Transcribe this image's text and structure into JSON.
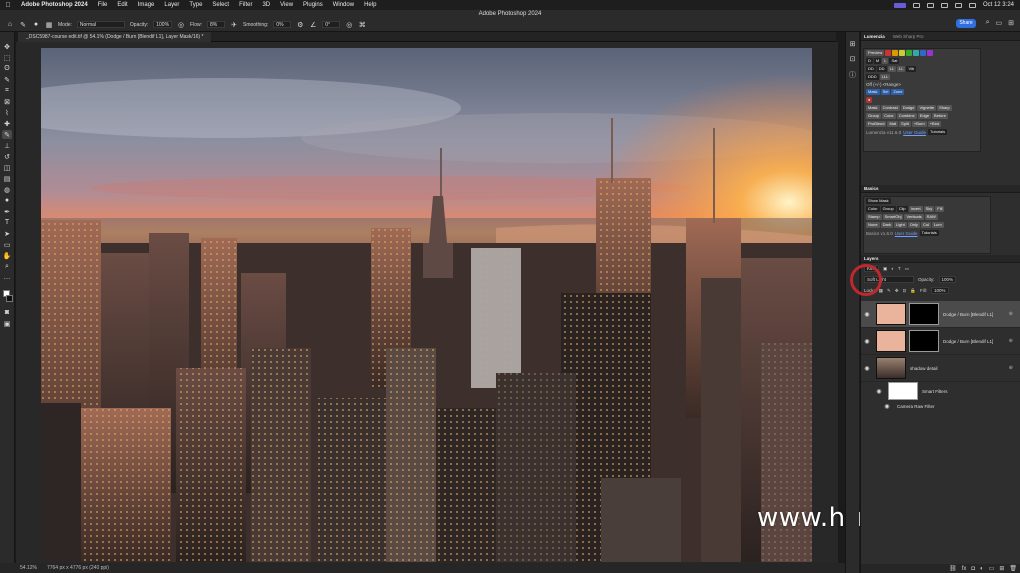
{
  "menubar": {
    "apple": "",
    "items": [
      "Adobe Photoshop 2024",
      "File",
      "Edit",
      "Image",
      "Layer",
      "Type",
      "Select",
      "Filter",
      "3D",
      "View",
      "Plugins",
      "Window",
      "Help"
    ],
    "clock": "Oct 12  3:24"
  },
  "window": {
    "title": "Adobe Photoshop 2024"
  },
  "options": {
    "mode_label": "Mode:",
    "mode_value": "Normal",
    "opacity_label": "Opacity:",
    "opacity_value": "100%",
    "flow_label": "Flow:",
    "flow_value": "8%",
    "smoothing_label": "Smoothing:",
    "smoothing_value": "0%",
    "angle_value": "0°",
    "share_label": "Share"
  },
  "document": {
    "tab_label": "_DSC5987-course edit.tif @ 54.1% (Dodge / Burn [Blendif L1], Layer Mask/16) *"
  },
  "status": {
    "zoom": "54.12%",
    "dimensions": "7764 px x 4776 px (240 ppi)"
  },
  "watermark": "www.hunls.com",
  "panels": {
    "lumenzia_tabs": [
      "Lumenzia",
      "Web Sharp Pro"
    ],
    "lumenzia": {
      "preview": "Preview",
      "zones_row1": [
        "D",
        "M",
        "L",
        "Sat"
      ],
      "zones_row2": [
        "DD",
        "DD",
        "LL",
        "LL",
        "Vib"
      ],
      "zones_row3": [
        "DDD",
        "LLL"
      ],
      "off_label": "Off (+/-)",
      "range_label": "<Range>",
      "row_selectors": [
        "Mask",
        "Sel",
        "Zone"
      ],
      "row_actions1": [
        "Mask",
        "Contrast",
        "Dodge",
        "Vignette",
        "Sharp"
      ],
      "row_actions2": [
        "Group",
        "Color",
        "Combine",
        "Edge",
        "Before"
      ],
      "row_actions3": [
        "ProBlend",
        "Mat",
        "Split",
        "+Burn",
        "+Bird"
      ],
      "version": "Lumenzia v11.6.0",
      "user_guide": "User Guide",
      "tutorials": "Tutorials"
    },
    "basics": {
      "title": "Basics",
      "show_mask": "Show Mask",
      "row2": [
        "Color",
        "Group",
        "Clip",
        "Invert",
        "Sky",
        "Fill"
      ],
      "row3": [
        "None",
        "Dark",
        "Light",
        "Only",
        "Col",
        "Lum"
      ],
      "row_actions": [
        "Stamp",
        "SmartObj",
        "Verticals",
        "RAW"
      ],
      "version": "Basics v1.6.0",
      "user_guide": "User Guide",
      "tutorials": "Tutorials"
    },
    "layers": {
      "title": "Layers",
      "kind": "Kind",
      "blend_mode": "Soft Light",
      "opacity_label": "Opacity:",
      "opacity_value": "100%",
      "lock_label": "Lock:",
      "fill_label": "Fill:",
      "fill_value": "100%",
      "items": [
        {
          "name": "Dodge / Burn [Blendif L1]"
        },
        {
          "name": "Dodge / Burn [Blendif L1]"
        },
        {
          "name": "shadow detail"
        }
      ],
      "smart_filters": "Smart Filters",
      "camera_raw": "Camera Raw Filter"
    }
  }
}
